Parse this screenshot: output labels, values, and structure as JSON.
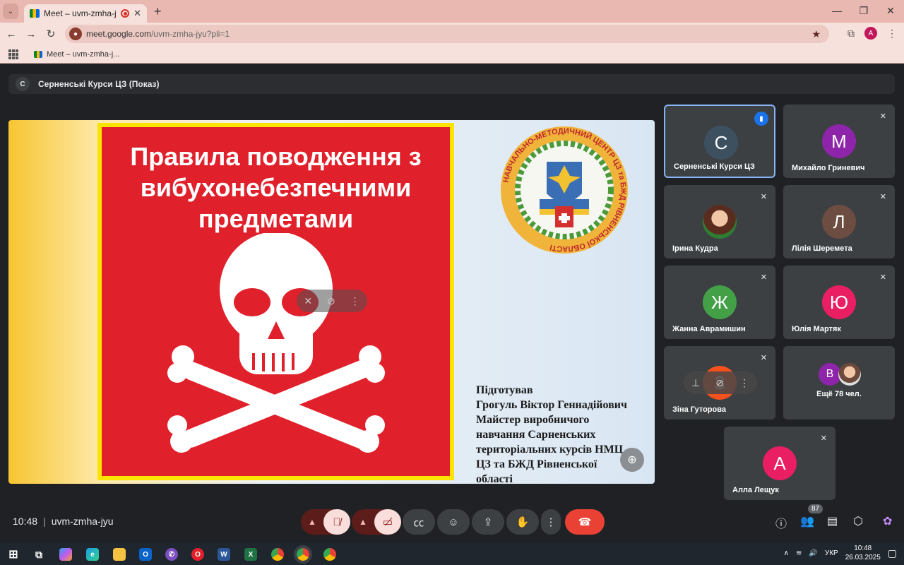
{
  "browser": {
    "tab_title": "Meet – uvm-zmha-jyu",
    "url_host": "meet.google.com",
    "url_path": "/uvm-zmha-jyu?pli=1",
    "profile_initial": "A",
    "bookmark_label": "Meet – uvm-zmha-j..."
  },
  "meet": {
    "presenter_initial": "С",
    "presenter_label": "Серненські Курси ЦЗ (Показ)",
    "meeting_time": "10:48",
    "meeting_code": "uvm-zmha-jyu",
    "participant_count": "87"
  },
  "slide": {
    "title_line1": "Правила поводження з",
    "title_line2": "вибухонебезпечними",
    "title_line3": "предметами",
    "emblem_text": "НАВЧАЛЬНО-МЕТОДИЧНИЙ ЦЕНТР ЦЗ та БЖД РІВНЕНСЬКОЇ ОБЛАСТІ",
    "credit_line1": "Підготував",
    "credit_line2": "Грогуль Віктор Геннадійович",
    "credit_line3": "Майстер виробничого",
    "credit_line4": "навчання Сарненських",
    "credit_line5": "територіальних курсів НМЦ",
    "credit_line6": "ЦЗ та БЖД Рівненської",
    "credit_line7": "області"
  },
  "participants": [
    {
      "initial": "С",
      "name": "Серненські Курси ЦЗ",
      "color": "#3c5060"
    },
    {
      "initial": "М",
      "name": "Михайло Гриневич",
      "color": "#8e24aa"
    },
    {
      "initial": "",
      "name": "Ірина Кудра",
      "color": "#a0522d"
    },
    {
      "initial": "Л",
      "name": "Лілія Шеремета",
      "color": "#6d4c41"
    },
    {
      "initial": "Ж",
      "name": "Жанна Аврамишин",
      "color": "#43a047"
    },
    {
      "initial": "Ю",
      "name": "Юлія Мартяк",
      "color": "#e91e63"
    },
    {
      "initial": "З",
      "name": "Зіна Гуторова",
      "color": "#f4511e"
    },
    {
      "initial": "В",
      "name": "Ещё 78 чел.",
      "color": "#8e24aa"
    },
    {
      "initial": "А",
      "name": "Алла Лещук",
      "color": "#e91e63"
    }
  ],
  "taskbar": {
    "lang": "УКР",
    "time": "10:48",
    "date": "26.03.2025"
  }
}
